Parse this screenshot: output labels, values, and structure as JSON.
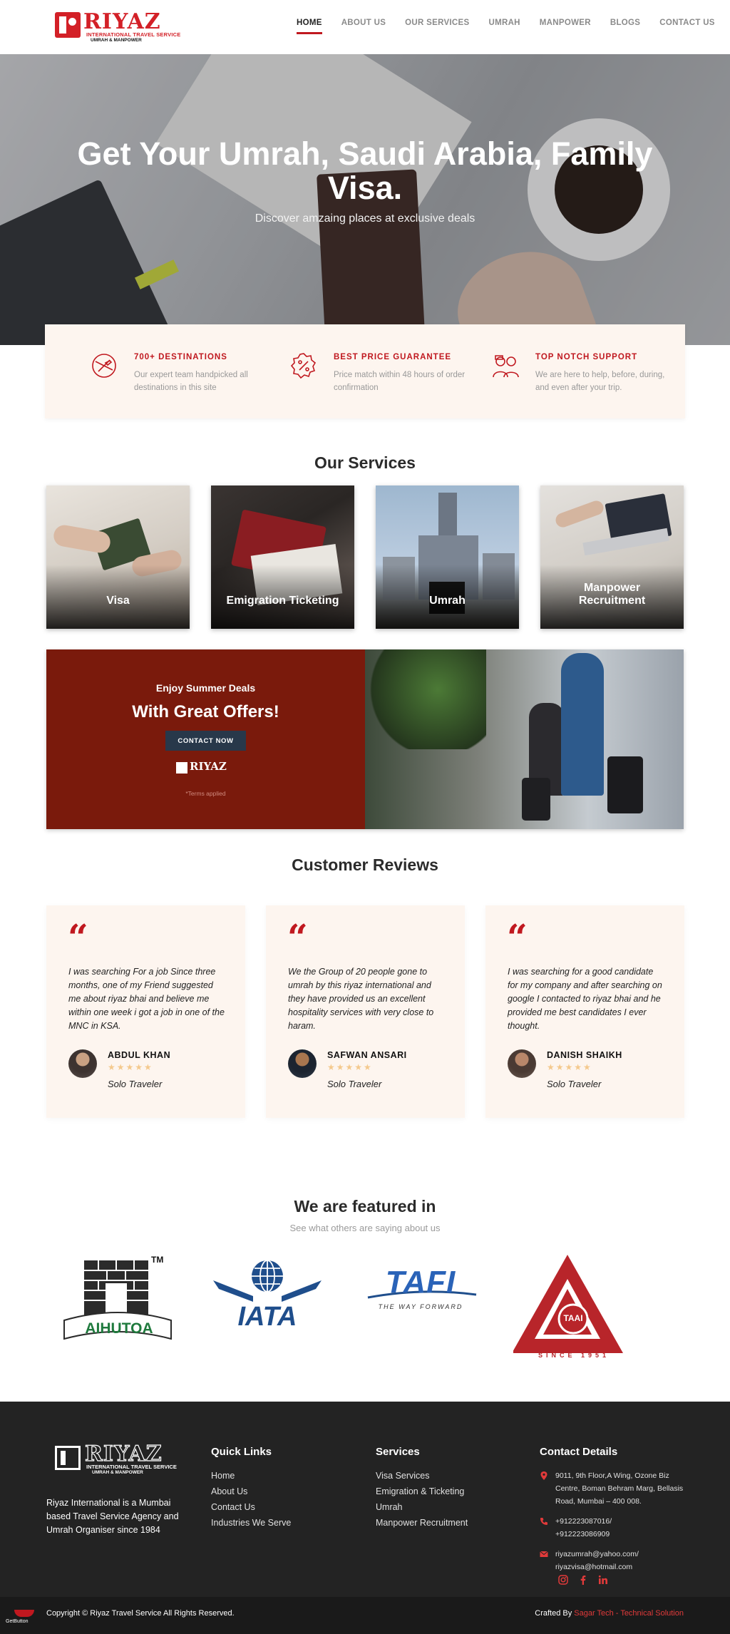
{
  "brand": {
    "name": "RIYAZ",
    "tagline": "INTERNATIONAL TRAVEL SERVICE",
    "subline": "UMRAH & MANPOWER",
    "accent": "#c0181f"
  },
  "nav": {
    "items": [
      "HOME",
      "ABOUT US",
      "OUR SERVICES",
      "UMRAH",
      "MANPOWER",
      "BLOGS",
      "CONTACT US"
    ],
    "active": "HOME"
  },
  "hero": {
    "title": "Get Your Umrah, Saudi Arabia, Family Visa.",
    "subtitle": "Discover amzaing places at exclusive deals"
  },
  "features": [
    {
      "icon": "globe-plane-icon",
      "title": "700+ DESTINATIONS",
      "text": "Our expert team handpicked all destinations in this site"
    },
    {
      "icon": "discount-badge-icon",
      "title": "BEST PRICE GUARANTEE",
      "text": "Price match within 48 hours of order confirmation"
    },
    {
      "icon": "support-team-icon",
      "title": "TOP NOTCH SUPPORT",
      "text": "We are here to help, before, during, and even after your trip."
    }
  ],
  "services": {
    "title": "Our Services",
    "items": [
      "Visa",
      "Emigration Ticketing",
      "Umrah",
      "Manpower Recruitment"
    ]
  },
  "promo": {
    "kicker": "Enjoy Summer Deals",
    "headline": "With Great Offers!",
    "button": "CONTACT NOW",
    "terms": "*Terms applied"
  },
  "reviews": {
    "title": "Customer Reviews",
    "items": [
      {
        "text": "I was searching For a job Since three months, one of my Friend suggested me about riyaz bhai and believe me within one week i got a job in one of the MNC in KSA.",
        "name": "ABDUL KHAN",
        "role": "Solo Traveler",
        "stars": 5
      },
      {
        "text": "We the Group of 20 people gone to umrah by this riyaz international and they have provided us an excellent hospitality services with very close to haram.",
        "name": "SAFWAN ANSARI",
        "role": "Solo Traveler",
        "stars": 5
      },
      {
        "text": "I was searching for a good candidate for my company and after searching on google I contacted to riyaz bhai and he provided me best candidates I ever thought.",
        "name": "DANISH SHAIKH",
        "role": "Solo Traveler",
        "stars": 5
      }
    ]
  },
  "featured": {
    "title": "We are featured in",
    "subtitle": "See what others are saying about us",
    "partners": [
      {
        "name": "AIHUTOA",
        "mark": "TM"
      },
      {
        "name": "IATA"
      },
      {
        "name": "TAFI",
        "tag": "THE WAY FORWARD"
      },
      {
        "name": "TAAI",
        "tag": "SINCE 1951"
      }
    ]
  },
  "footer": {
    "about": "Riyaz International is a Mumbai based Travel Service Agency and Umrah Organiser since 1984",
    "quick_links": {
      "title": "Quick Links",
      "items": [
        "Home",
        "About Us",
        "Contact Us",
        "Industries We Serve"
      ]
    },
    "services": {
      "title": "Services",
      "items": [
        "Visa Services",
        "Emigration & Ticketing",
        "Umrah",
        "Manpower Recruitment"
      ]
    },
    "contact": {
      "title": "Contact Details",
      "address": "9011, 9th Floor,A Wing, Ozone Biz Centre, Boman Behram Marg, Bellasis Road, Mumbai – 400 008.",
      "phone1": "+912223087016/",
      "phone2": "+912223086909",
      "email1": "riyazumrah@yahoo.com/",
      "email2": "riyazvisa@hotmail.com"
    },
    "copyright": "Copyright © Riyaz Travel Service All Rights Reserved.",
    "crafted_prefix": "Crafted By",
    "crafted_by": "Sagar Tech - Technical Solution",
    "getbutton": "GetButton"
  }
}
